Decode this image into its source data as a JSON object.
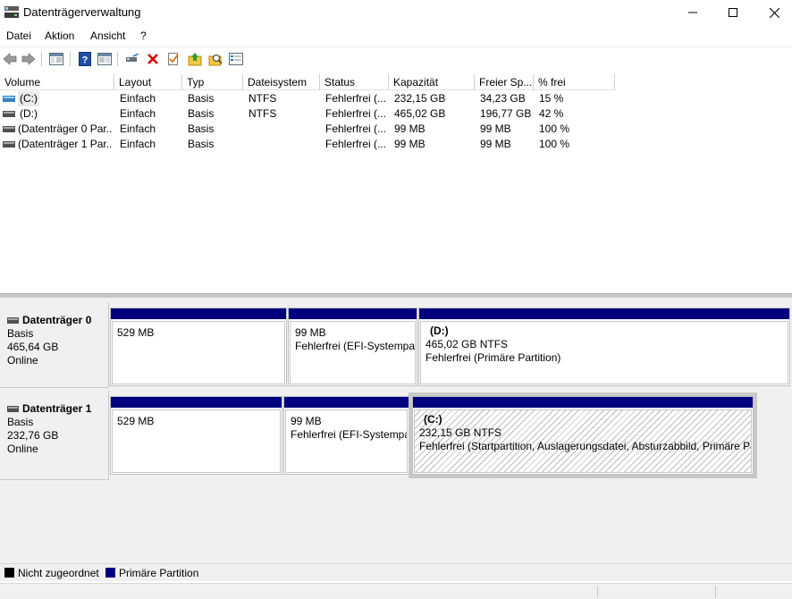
{
  "window": {
    "title": "Datenträgerverwaltung",
    "controls": [
      "minimize",
      "maximize",
      "close"
    ]
  },
  "menu": [
    "Datei",
    "Aktion",
    "Ansicht",
    "?"
  ],
  "toolbar": {
    "buttons": [
      "back-arrow-icon",
      "forward-arrow-icon",
      "console-tree-icon",
      "help-icon",
      "properties-pane-icon",
      "connect-disk-icon",
      "delete-icon",
      "check-icon",
      "up-folder-icon",
      "search-folder-icon",
      "properties-icon"
    ]
  },
  "volume_table": {
    "columns": [
      "Volume",
      "Layout",
      "Typ",
      "Dateisystem",
      "Status",
      "Kapazität",
      "Freier Sp...",
      "% frei"
    ],
    "rows": [
      {
        "volume": "(C:)",
        "layout": "Einfach",
        "typ": "Basis",
        "dateisystem": "NTFS",
        "status": "Fehlerfrei (...",
        "kapazitaet": "232,15 GB",
        "frei": "34,23 GB",
        "prozent": "15 %"
      },
      {
        "volume": "(D:)",
        "layout": "Einfach",
        "typ": "Basis",
        "dateisystem": "NTFS",
        "status": "Fehlerfrei (...",
        "kapazitaet": "465,02 GB",
        "frei": "196,77 GB",
        "prozent": "42 %"
      },
      {
        "volume": "(Datenträger 0 Par...",
        "layout": "Einfach",
        "typ": "Basis",
        "dateisystem": "",
        "status": "Fehlerfrei (...",
        "kapazitaet": "99 MB",
        "frei": "99 MB",
        "prozent": "100 %"
      },
      {
        "volume": "(Datenträger 1 Par...",
        "layout": "Einfach",
        "typ": "Basis",
        "dateisystem": "",
        "status": "Fehlerfrei (...",
        "kapazitaet": "99 MB",
        "frei": "99 MB",
        "prozent": "100 %"
      }
    ]
  },
  "disks": [
    {
      "name": "Datenträger 0",
      "type": "Basis",
      "size": "465,64 GB",
      "state": "Online",
      "partitions": [
        {
          "title": "",
          "line1": "529 MB",
          "line2": ""
        },
        {
          "title": "",
          "line1": "99 MB",
          "line2": "Fehlerfrei (EFI-Systempar"
        },
        {
          "title": "(D:)",
          "line1": "465,02 GB NTFS",
          "line2": "Fehlerfrei (Primäre Partition)"
        }
      ]
    },
    {
      "name": "Datenträger 1",
      "type": "Basis",
      "size": "232,76 GB",
      "state": "Online",
      "partitions": [
        {
          "title": "",
          "line1": "529 MB",
          "line2": ""
        },
        {
          "title": "",
          "line1": "99 MB",
          "line2": "Fehlerfrei (EFI-Systempa"
        },
        {
          "title": "(C:)",
          "line1": "232,15 GB NTFS",
          "line2": "Fehlerfrei (Startpartition, Auslagerungsdatei, Absturzabbild, Primäre Pa"
        }
      ]
    }
  ],
  "legend": [
    {
      "label": "Nicht zugeordnet",
      "color": "#000000"
    },
    {
      "label": "Primäre Partition",
      "color": "#00007f"
    }
  ],
  "colors": {
    "primary_partition": "#00007f",
    "unallocated": "#000000",
    "delete": "#d40000"
  }
}
